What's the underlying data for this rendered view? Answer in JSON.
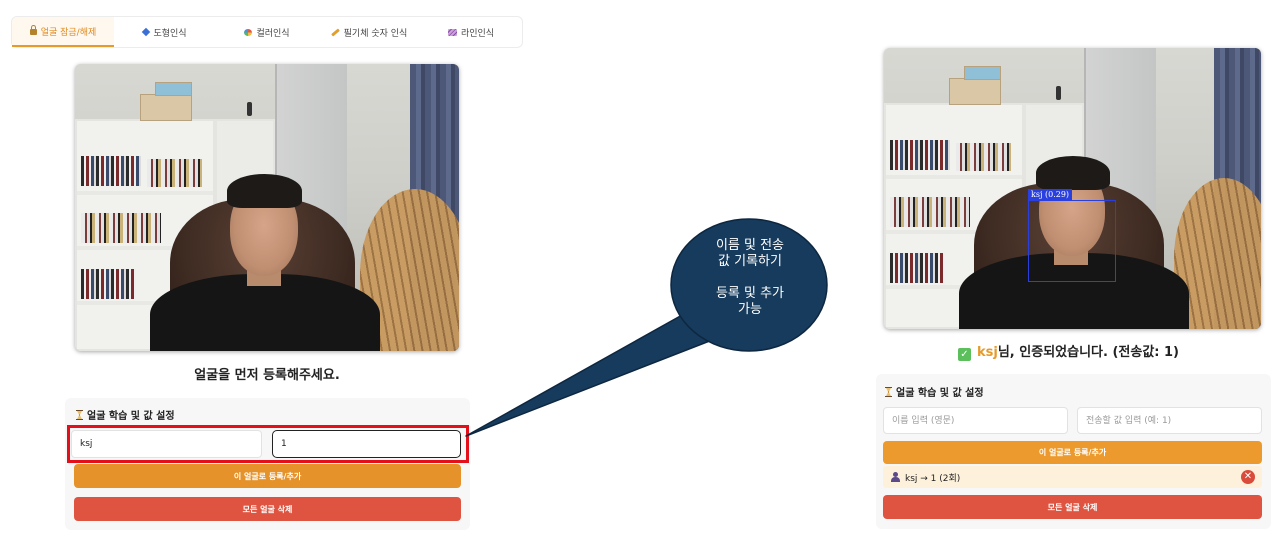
{
  "tabs": [
    {
      "label": "얼굴 잠금/해제",
      "icon": "lock-icon",
      "active": true
    },
    {
      "label": "도형인식",
      "icon": "diamond-icon"
    },
    {
      "label": "컬러인식",
      "icon": "palette-icon"
    },
    {
      "label": "필기체 숫자 인식",
      "icon": "pencil-icon"
    },
    {
      "label": "라인인식",
      "icon": "lines-icon"
    }
  ],
  "left": {
    "camera_caption": "얼굴을 먼저 등록해주세요.",
    "panel_title": "얼굴 학습 및 값 설정",
    "name_value": "ksj",
    "send_value": "1",
    "register_button": "이 얼굴로 등록/추가",
    "delete_all_button": "모든 얼굴 삭제"
  },
  "callout": {
    "text": "이름 및 전송\n값 기록하기\n\n등록 및 추가\n가능"
  },
  "right": {
    "detection_label": "ksj (0.29)",
    "auth_name": "ksj",
    "auth_message": "님, 인증되었습니다. (전송값: 1)",
    "panel_title": "얼굴 학습 및 값 설정",
    "name_placeholder": "이름 입력 (영문)",
    "send_placeholder": "전송할 값 입력 (예: 1)",
    "register_button": "이 얼굴로 등록/추가",
    "entry_text": "ksj → 1 (2회)",
    "delete_all_button": "모든 얼굴 삭제"
  },
  "colors": {
    "accent_orange": "#ec9a2d",
    "danger_red": "#df5440",
    "highlight_red": "#e3101b",
    "callout_navy": "#163b5c",
    "detection_blue": "#2a3fe0"
  }
}
